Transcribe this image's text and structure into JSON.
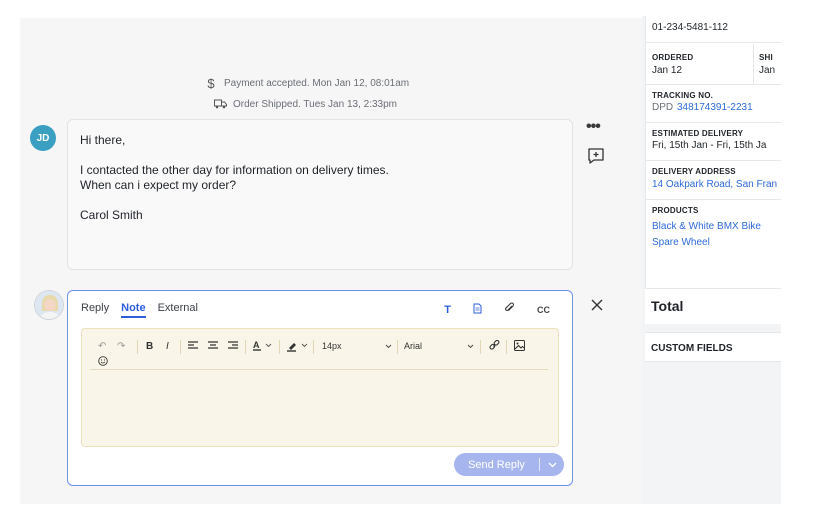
{
  "timeline": [
    {
      "icon": "dollar-icon",
      "text": "Payment accepted. Mon Jan 12, 08:01am"
    },
    {
      "icon": "truck-icon",
      "text": "Order Shipped. Tues Jan 13, 2:33pm"
    }
  ],
  "message": {
    "author_initials": "JD",
    "lines": [
      "Hi there,",
      "",
      "I contacted the other day for information on delivery times.",
      "When can i expect my order?",
      "",
      "Carol Smith"
    ]
  },
  "reply": {
    "tabs": [
      {
        "label": "Reply",
        "active": false
      },
      {
        "label": "Note",
        "active": true
      },
      {
        "label": "External",
        "active": false
      }
    ],
    "cc_label": "CC",
    "font_size": "14px",
    "font_family": "Arial",
    "send_label": "Send Reply"
  },
  "sidebar": {
    "phone": "01-234-5481-112",
    "ordered_label": "ORDERED",
    "ordered_value": "Jan 12",
    "shipped_label": "SHI",
    "shipped_value": "Jan",
    "tracking_label": "TRACKING NO.",
    "tracking_carrier": "DPD",
    "tracking_number": "348174391-2231",
    "estimated_label": "ESTIMATED DELIVERY",
    "estimated_value": "Fri, 15th Jan - Fri, 15th Ja",
    "address_label": "DELIVERY ADDRESS",
    "address_value": "14 Oakpark Road, San Fran",
    "products_label": "PRODUCTS",
    "products": [
      "Black & White BMX Bike",
      "Spare Wheel"
    ],
    "total_label": "Total",
    "custom_fields_label": "CUSTOM FIELDS"
  },
  "colors": {
    "accent": "#2d5fd8",
    "avatar_bg": "#3a9fc1",
    "send_button": "#a6b5ee",
    "editor_bg": "#f9f5e8",
    "link": "#2d6bd8"
  }
}
